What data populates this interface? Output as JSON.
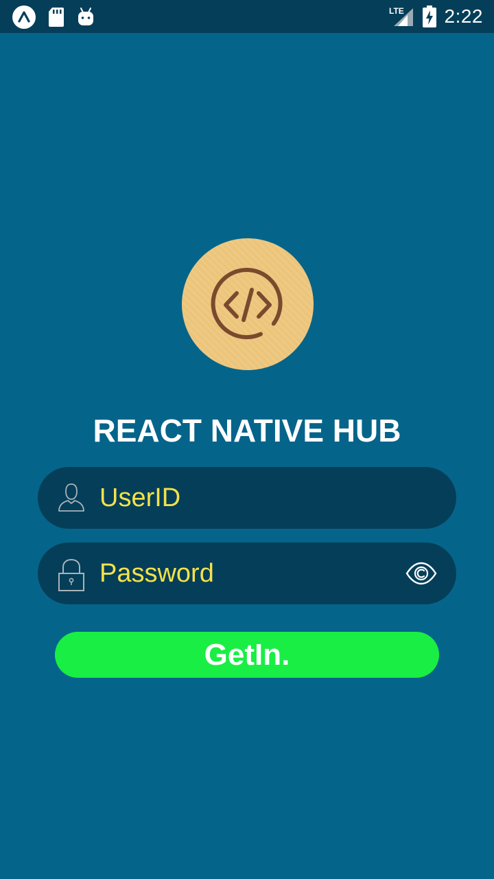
{
  "status_bar": {
    "time": "2:22",
    "network": "LTE",
    "left_icons": [
      "expo-icon",
      "sd-card-icon",
      "android-icon"
    ],
    "right_icons": [
      "lte-signal-icon",
      "battery-charging-icon"
    ]
  },
  "logo": {
    "icon": "code-icon",
    "color": "#ecc57b",
    "glyph_color": "#7a4a2e"
  },
  "app_title": "REACT NATIVE HUB",
  "login_form": {
    "userid_placeholder": "UserID",
    "password_placeholder": "Password",
    "user_icon": "user-icon",
    "lock_icon": "lock-icon",
    "eye_icon": "eye-icon",
    "submit_label": "GetIn."
  },
  "colors": {
    "background": "#05648a",
    "status_bar": "#053e58",
    "field_bg": "#053e58",
    "placeholder": "#f3e24a",
    "button": "#19ee45",
    "button_text": "#ffffff"
  }
}
